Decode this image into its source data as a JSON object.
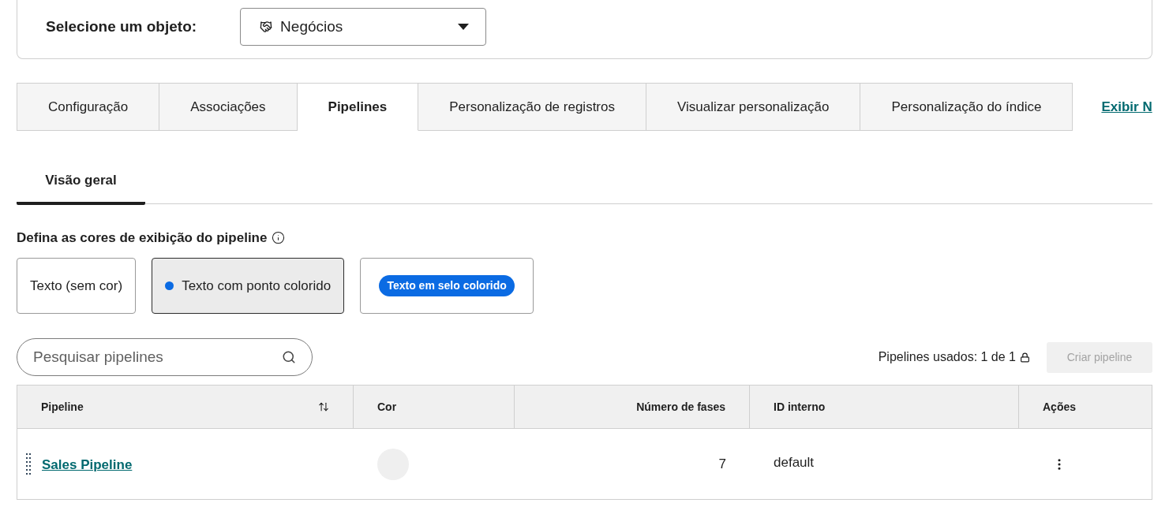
{
  "object_selector": {
    "label": "Selecione um objeto:",
    "value": "Negócios"
  },
  "tabs": [
    {
      "label": "Configuração",
      "selected": false
    },
    {
      "label": "Associações",
      "selected": false
    },
    {
      "label": "Pipelines",
      "selected": true
    },
    {
      "label": "Personalização de registros",
      "selected": false
    },
    {
      "label": "Visualizar personalização",
      "selected": false
    },
    {
      "label": "Personalização do índice",
      "selected": false
    }
  ],
  "tab_link": {
    "label": "Exibir N"
  },
  "subtabs": [
    {
      "label": "Visão geral",
      "selected": true
    }
  ],
  "color_display": {
    "title": "Defina as cores de exibição do pipeline",
    "options": [
      {
        "kind": "plain",
        "label": "Texto (sem cor)",
        "selected": false
      },
      {
        "kind": "dot",
        "label": "Texto com ponto colorido",
        "selected": true
      },
      {
        "kind": "badge",
        "label": "Texto em selo colorido",
        "selected": false
      }
    ]
  },
  "search": {
    "placeholder": "Pesquisar pipelines"
  },
  "usage": {
    "text": "Pipelines usados: 1 de 1"
  },
  "create_button": {
    "label": "Criar pipeline",
    "disabled": true
  },
  "table": {
    "columns": [
      {
        "label": "Pipeline",
        "kind": "sortable"
      },
      {
        "label": "Cor",
        "kind": "text"
      },
      {
        "label": "Número de fases",
        "kind": "number"
      },
      {
        "label": "ID interno",
        "kind": "text"
      },
      {
        "label": "Ações",
        "kind": "text"
      }
    ],
    "rows": [
      {
        "name": "Sales Pipeline",
        "color": "#efefef",
        "phases": "7",
        "internal_id": "default"
      }
    ]
  }
}
